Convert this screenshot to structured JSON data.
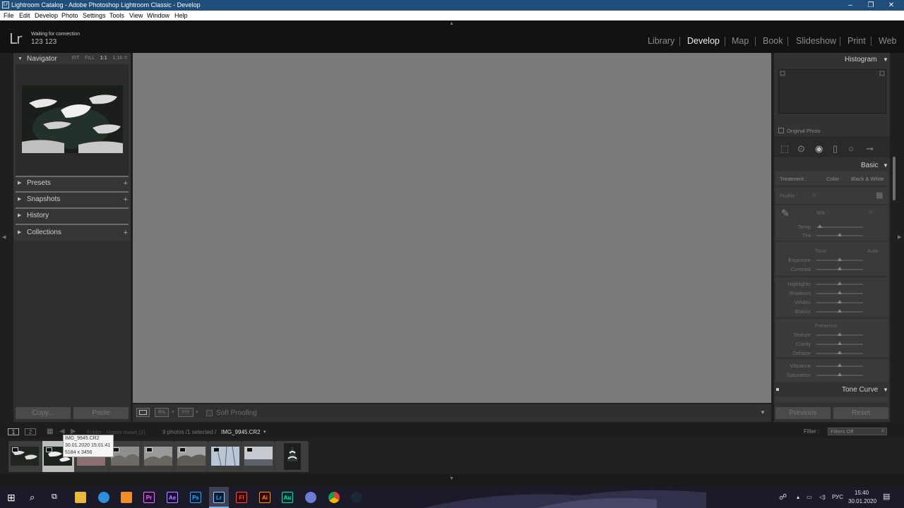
{
  "window": {
    "title": "Lightroom Catalog - Adobe Photoshop Lightroom Classic - Develop",
    "controls": [
      "–",
      "❐",
      "✕"
    ]
  },
  "menu": [
    "File",
    "Edit",
    "Develop",
    "Photo",
    "Settings",
    "Tools",
    "View",
    "Window",
    "Help"
  ],
  "identity": {
    "logo": "Lr",
    "status": "Waiting for connection",
    "user": "123 123"
  },
  "modules": {
    "items": [
      "Library",
      "Develop",
      "Map",
      "Book",
      "Slideshow",
      "Print",
      "Web"
    ],
    "active": "Develop"
  },
  "left_panel": {
    "navigator": {
      "title": "Navigator",
      "options": [
        "FIT",
        "FILL",
        "1:1",
        "1:16 ≑"
      ],
      "active_option": "1:1"
    },
    "presets": "Presets",
    "snapshots": "Snapshots",
    "history": "History",
    "collections": "Collections",
    "copy_label": "Copy...",
    "paste_label": "Paste"
  },
  "toolbar": {
    "soft_proofing": "Soft Proofing",
    "ra": "RA",
    "yy": "Y|Y"
  },
  "right_panel": {
    "histogram": {
      "title": "Histogram",
      "original_photo": "Original Photo"
    },
    "basic": {
      "title": "Basic",
      "treatment_label": "Treatment :",
      "color": "Color",
      "bw": "Black & White",
      "profile_label": "Profile :",
      "wb_label": "WB :",
      "temp": "Temp",
      "tint": "Tint",
      "tone": "Tone",
      "auto": "Auto",
      "exposure": "Exposure",
      "contrast": "Contrast",
      "highlights": "Highlights",
      "shadows": "Shadows",
      "whites": "Whites",
      "blacks": "Blacks",
      "presence": "Presence",
      "texture": "Texture",
      "clarity": "Clarity",
      "dehaze": "Dehaze",
      "vibrance": "Vibrance",
      "saturation": "Saturation"
    },
    "tone_curve": "Tone Curve",
    "previous_label": "Previous",
    "reset_label": "Reset"
  },
  "filmstrip": {
    "view1": "1",
    "view2": "2",
    "folder_label": "Folder : Новая папка (2)",
    "count": "9 photos /1 selected /",
    "filename": "IMG_9945.CR2",
    "filter_label": "Filter :",
    "filter_value": "Filters Off",
    "tooltip": {
      "name": "IMG_9945.CR2",
      "date": "30.01.2020 15:01:41",
      "size": "5184 x 3456"
    }
  },
  "taskbar": {
    "apps": [
      "Pr",
      "Ae",
      "Ps",
      "Lr",
      "Fl",
      "Ai",
      "Au"
    ],
    "lang": "РУС",
    "time": "15:40",
    "date": "30.01.2020"
  },
  "colors": {
    "accent": "#1e4e79",
    "main_bg": "#7a7a7a",
    "panel": "#353535"
  }
}
